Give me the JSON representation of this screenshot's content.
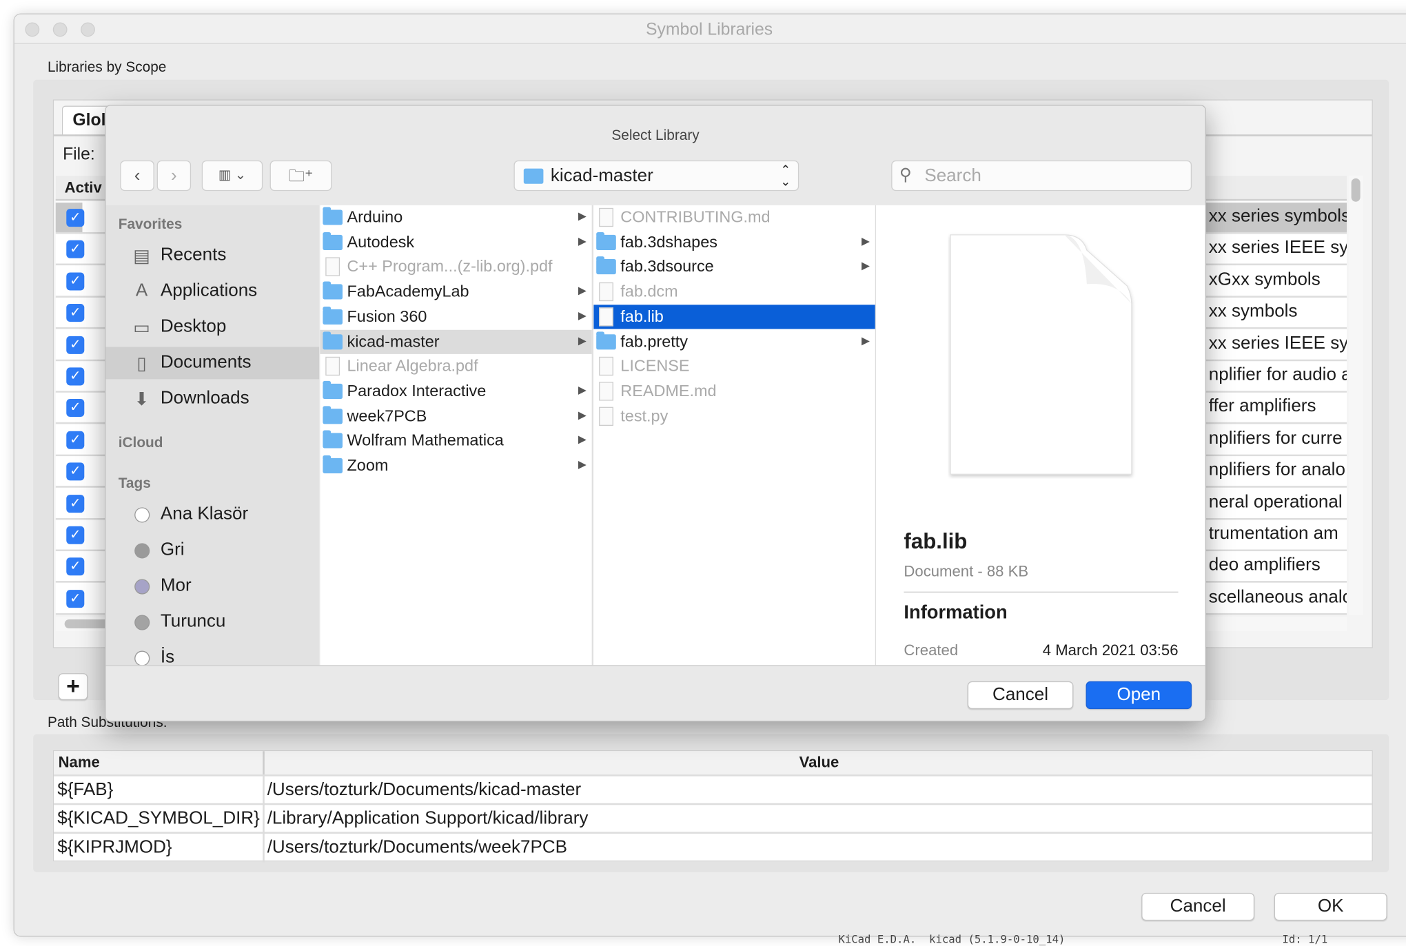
{
  "window": {
    "title": "Symbol Libraries"
  },
  "libraries": {
    "section_label": "Libraries by Scope",
    "tab_label": "Glol",
    "file_label": "File:",
    "active_header": "Activ",
    "rows": [
      {
        "checked": true,
        "desc": "xx series symbols"
      },
      {
        "checked": true,
        "desc": "xx series IEEE sym"
      },
      {
        "checked": true,
        "desc": "xGxx symbols"
      },
      {
        "checked": true,
        "desc": "xx symbols"
      },
      {
        "checked": true,
        "desc": "xx series IEEE sym"
      },
      {
        "checked": true,
        "desc": "nplifier for audio a"
      },
      {
        "checked": true,
        "desc": "ffer amplifiers"
      },
      {
        "checked": true,
        "desc": "nplifiers for curre"
      },
      {
        "checked": true,
        "desc": "nplifiers for analo"
      },
      {
        "checked": true,
        "desc": "neral operational"
      },
      {
        "checked": true,
        "desc": "trumentation am"
      },
      {
        "checked": true,
        "desc": "deo amplifiers"
      },
      {
        "checked": true,
        "desc": "scellaneous analo"
      }
    ],
    "add_button": "+"
  },
  "path_subs": {
    "section_label": "Path Substitutions:",
    "headers": {
      "name": "Name",
      "value": "Value"
    },
    "rows": [
      {
        "name": "${FAB}",
        "value": "/Users/tozturk/Documents/kicad-master"
      },
      {
        "name": "${KICAD_SYMBOL_DIR}",
        "value": "/Library/Application Support/kicad/library"
      },
      {
        "name": "${KIPRJMOD}",
        "value": "/Users/tozturk/Documents/week7PCB"
      }
    ]
  },
  "buttons": {
    "cancel": "Cancel",
    "ok": "OK"
  },
  "status_bar": {
    "left": "KiCad E.D.A.  kicad (5.1.9-0-10_14)",
    "right": "Id: 1/1"
  },
  "dialog": {
    "title": "Select Library",
    "path_popup": "kicad-master",
    "search_placeholder": "Search",
    "sidebar": {
      "favorites_header": "Favorites",
      "favorites": [
        {
          "label": "Recents",
          "icon": "recents-icon",
          "glyph": "▤"
        },
        {
          "label": "Applications",
          "icon": "applications-icon",
          "glyph": "A"
        },
        {
          "label": "Desktop",
          "icon": "desktop-icon",
          "glyph": "▭"
        },
        {
          "label": "Documents",
          "icon": "documents-icon",
          "glyph": "▯",
          "selected": true
        },
        {
          "label": "Downloads",
          "icon": "downloads-icon",
          "glyph": "⬇"
        }
      ],
      "icloud_header": "iCloud",
      "tags_header": "Tags",
      "tags": [
        {
          "label": "Ana Klasör",
          "color": "#ffffff"
        },
        {
          "label": "Gri",
          "color": "#9a9a9a"
        },
        {
          "label": "Mor",
          "color": "#a6a3c7"
        },
        {
          "label": "Turuncu",
          "color": "#a3a3a3"
        },
        {
          "label": "İs",
          "color": "#ffffff"
        }
      ]
    },
    "column1": [
      {
        "name": "Arduino",
        "type": "folder"
      },
      {
        "name": "Autodesk",
        "type": "folder"
      },
      {
        "name": "C++ Program...(z-lib.org).pdf",
        "type": "file",
        "dim": true
      },
      {
        "name": "FabAcademyLab",
        "type": "folder"
      },
      {
        "name": "Fusion 360",
        "type": "folder"
      },
      {
        "name": "kicad-master",
        "type": "folder",
        "selected": true
      },
      {
        "name": "Linear Algebra.pdf",
        "type": "file",
        "dim": true
      },
      {
        "name": "Paradox Interactive",
        "type": "folder"
      },
      {
        "name": "week7PCB",
        "type": "folder"
      },
      {
        "name": "Wolfram Mathematica",
        "type": "folder"
      },
      {
        "name": "Zoom",
        "type": "folder"
      }
    ],
    "column2": [
      {
        "name": "CONTRIBUTING.md",
        "type": "file",
        "dim": true
      },
      {
        "name": "fab.3dshapes",
        "type": "folder"
      },
      {
        "name": "fab.3dsource",
        "type": "folder"
      },
      {
        "name": "fab.dcm",
        "type": "file",
        "dim": true
      },
      {
        "name": "fab.lib",
        "type": "file",
        "selected": true
      },
      {
        "name": "fab.pretty",
        "type": "folder"
      },
      {
        "name": "LICENSE",
        "type": "file",
        "dim": true
      },
      {
        "name": "README.md",
        "type": "file",
        "dim": true
      },
      {
        "name": "test.py",
        "type": "file",
        "dim": true
      }
    ],
    "preview": {
      "filename": "fab.lib",
      "kind_size": "Document - 88 KB",
      "info_header": "Information",
      "created_label": "Created",
      "created_value": "4 March 2021 03:56"
    },
    "cancel": "Cancel",
    "open": "Open"
  },
  "colors": {
    "accent": "#1a6ef2",
    "selection": "#0a5fd8",
    "checkbox": "#2f7cf6",
    "folder": "#6cb6f2"
  }
}
